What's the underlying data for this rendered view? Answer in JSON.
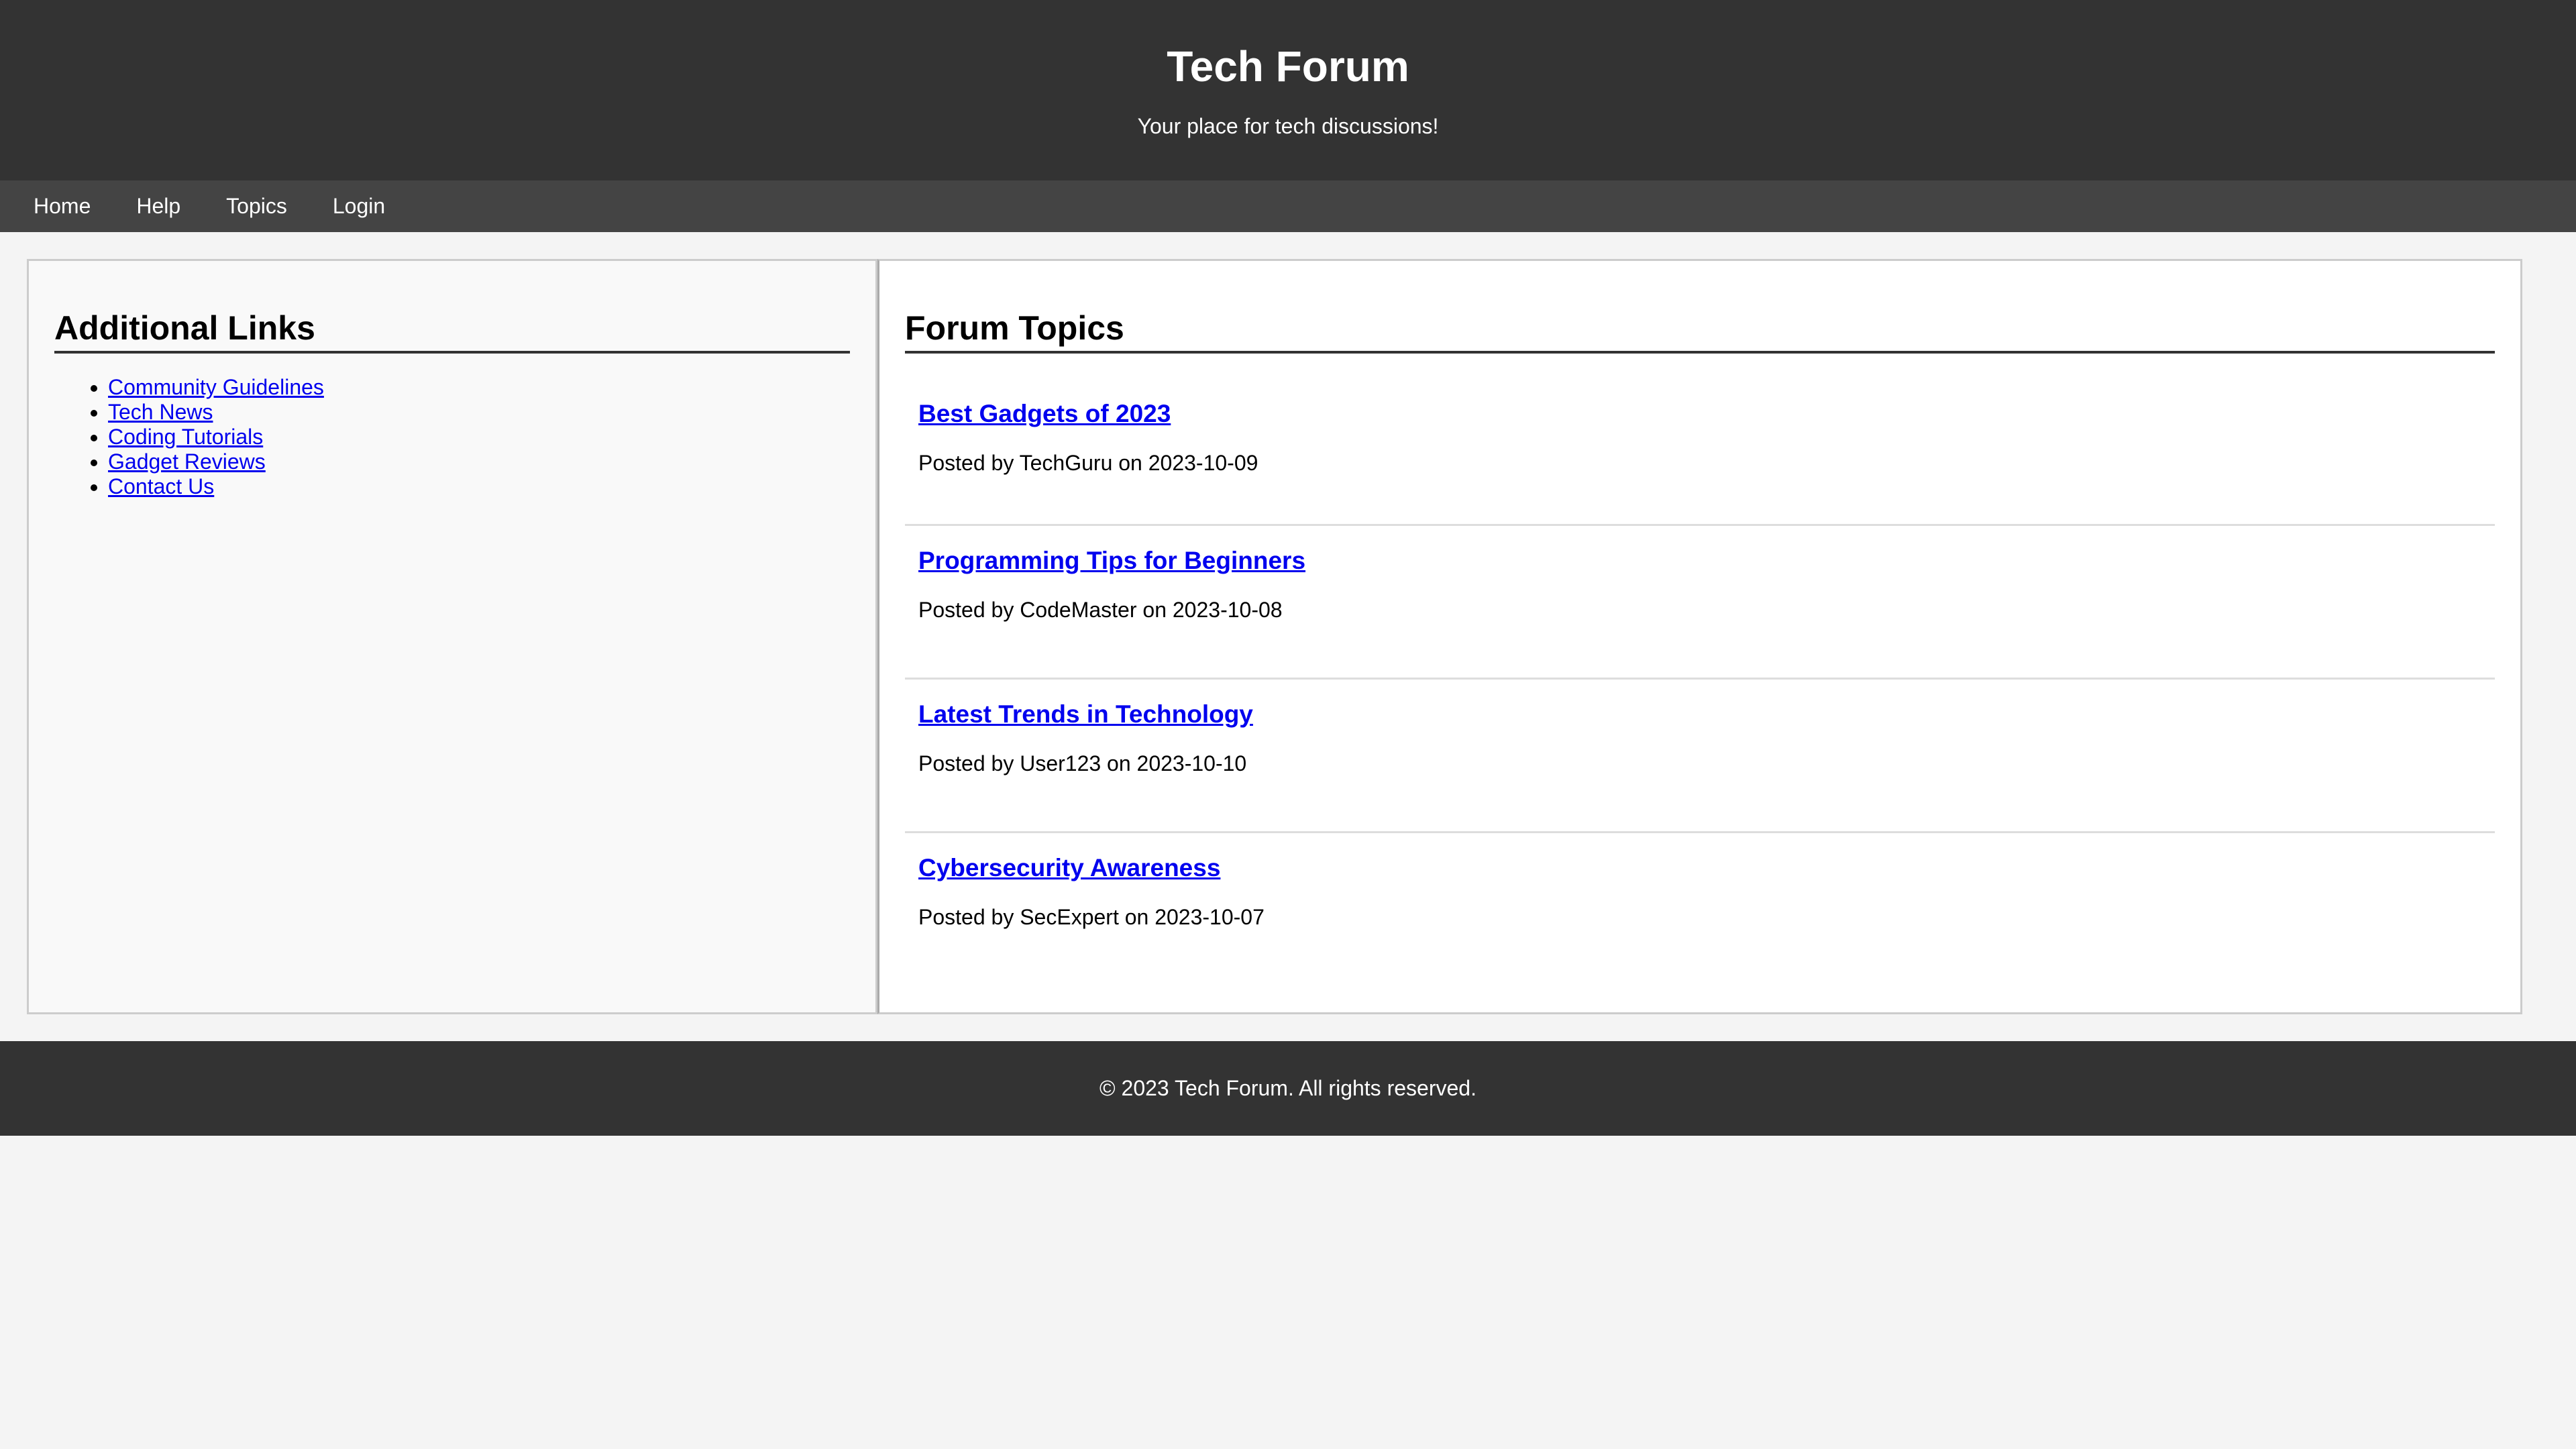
{
  "header": {
    "title": "Tech Forum",
    "tagline": "Your place for tech discussions!"
  },
  "nav": {
    "items": [
      {
        "label": "Home"
      },
      {
        "label": "Help"
      },
      {
        "label": "Topics"
      },
      {
        "label": "Login"
      }
    ]
  },
  "sidebar": {
    "heading": "Additional Links",
    "links": [
      {
        "label": "Community Guidelines"
      },
      {
        "label": "Tech News"
      },
      {
        "label": "Coding Tutorials"
      },
      {
        "label": "Gadget Reviews"
      },
      {
        "label": "Contact Us"
      }
    ]
  },
  "main": {
    "heading": "Forum Topics",
    "topics": [
      {
        "title": "Best Gadgets of 2023",
        "meta": "Posted by TechGuru on 2023-10-09"
      },
      {
        "title": "Programming Tips for Beginners",
        "meta": "Posted by CodeMaster on 2023-10-08"
      },
      {
        "title": "Latest Trends in Technology",
        "meta": "Posted by User123 on 2023-10-10"
      },
      {
        "title": "Cybersecurity Awareness",
        "meta": "Posted by SecExpert on 2023-10-07"
      }
    ]
  },
  "footer": {
    "text": "© 2023 Tech Forum. All rights reserved."
  },
  "colors": {
    "header_bg": "#333333",
    "nav_bg": "#444444",
    "link": "#0000ee",
    "page_bg": "#f4f4f4"
  }
}
